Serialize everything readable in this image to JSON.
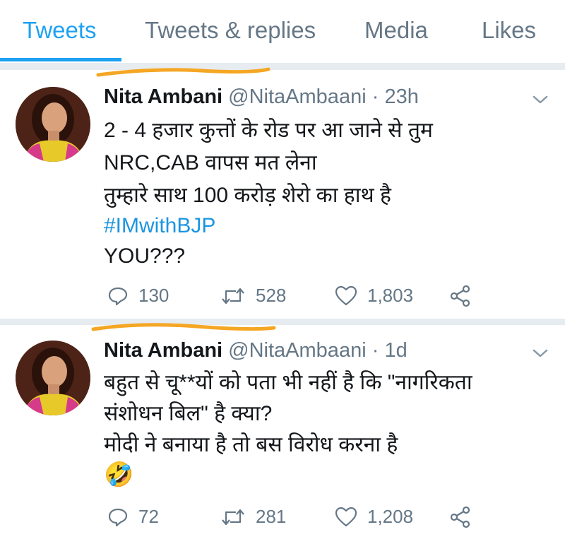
{
  "tabs": [
    {
      "label": "Tweets",
      "active": true
    },
    {
      "label": "Tweets & replies",
      "active": false
    },
    {
      "label": "Media",
      "active": false
    },
    {
      "label": "Likes",
      "active": false
    }
  ],
  "colors": {
    "accent": "#1da1f2",
    "hashtag": "#1b95e0",
    "muted": "#657786",
    "scribble": "#f5a623"
  },
  "tweets": [
    {
      "name": "Nita Ambani",
      "handle": "@NitaAmbaani",
      "separator": "·",
      "time": "23h",
      "lines": [
        "2 - 4 हजार कुत्तों के रोड पर आ जाने से तुम",
        "NRC,CAB  वापस मत लेना",
        "तुम्हारे साथ 100 करोड़ शेरो का हाथ है",
        "#IMwithBJP",
        "YOU???"
      ],
      "replies": "130",
      "retweets": "528",
      "likes": "1,803"
    },
    {
      "name": "Nita Ambani",
      "handle": "@NitaAmbaani",
      "separator": "·",
      "time": "1d",
      "lines": [
        "बहुत से चू**यों को पता भी नहीं है कि \"नागरिकता",
        "संशोधन बिल\" है क्या?",
        "मोदी ने बनाया है तो बस विरोध करना है",
        "🤣"
      ],
      "replies": "72",
      "retweets": "281",
      "likes": "1,208"
    }
  ]
}
